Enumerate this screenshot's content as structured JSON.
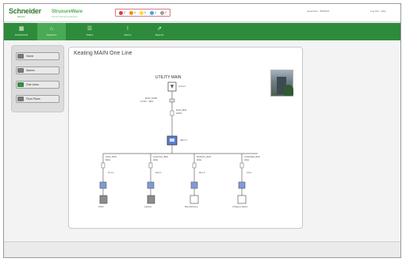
{
  "header": {
    "brand": "Schneider",
    "brand_sub": "Electric",
    "product": "StruxureWare",
    "product_sub": "Power Monitoring Expert",
    "alarm_counts": [
      "0",
      "4",
      "0",
      "1",
      "0"
    ],
    "user_info": "supervisor · 8/5/2013",
    "help_links": "Log Out · Help"
  },
  "nav": [
    {
      "label": "Dashboards",
      "icon": "dashboard-icon"
    },
    {
      "label": "Diagrams",
      "icon": "diagram-icon"
    },
    {
      "label": "Tables",
      "icon": "table-icon"
    },
    {
      "label": "Alarms",
      "icon": "alarm-icon"
    },
    {
      "label": "Reports",
      "icon": "report-icon"
    }
  ],
  "sidebar": [
    {
      "label": "Home"
    },
    {
      "label": "Alarms"
    },
    {
      "label": "One Lines"
    },
    {
      "label": "Floor Plans"
    }
  ],
  "main": {
    "title": "Keating MAIN One Line",
    "diagram": {
      "utility_title": "UTILITY MAIN",
      "utility_value": "12.8 kV",
      "feeder_label": "MAIN_XFMR",
      "feeder_value": "12.5kV - 480V",
      "main_label": "MAIN_BKR",
      "main_value": "2000A",
      "meter_value": "480.2 V",
      "branches": [
        {
          "bkr": "HVAC_BKR",
          "rating": "800A",
          "value": "97.2 A",
          "load": "HVAC"
        },
        {
          "bkr": "LIGHTING_BKR",
          "rating": "400A",
          "value": "48.6 A",
          "load": "Lighting"
        },
        {
          "bkr": "MANUFG_BKR",
          "rating": "600A",
          "value": "86.1 A",
          "load": "Manufacturing"
        },
        {
          "bkr": "CHARGER_BKR",
          "rating": "200A",
          "value": "3.8 A",
          "load": "Charging Station"
        }
      ]
    }
  },
  "colors": {
    "brand_green": "#2e8b3b",
    "nav_active": "#49a955",
    "meter_blue": "#5b7fd0"
  }
}
